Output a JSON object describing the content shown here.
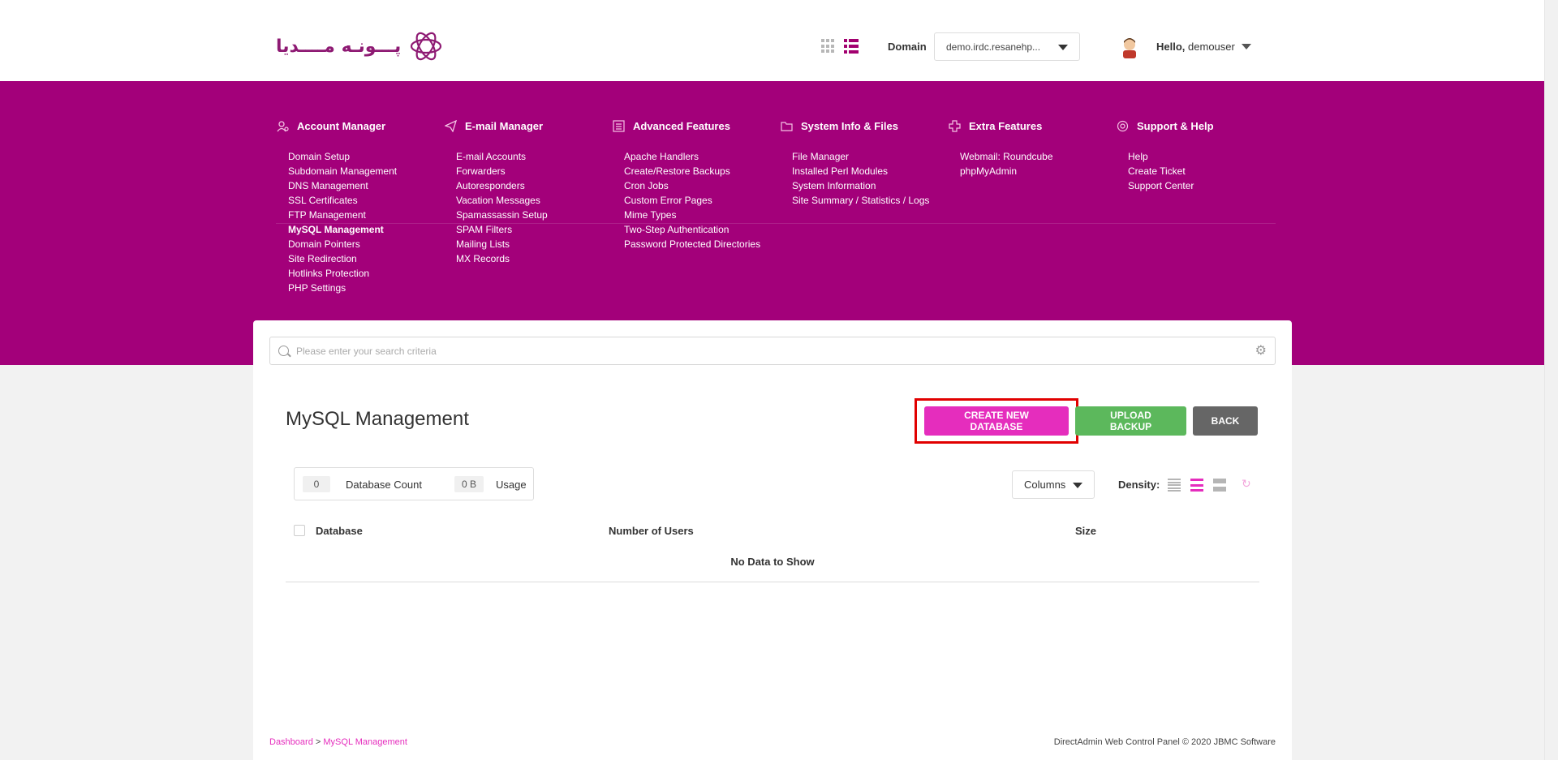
{
  "header": {
    "logo_text": "پـــونـه مــــدیا",
    "domain_label": "Domain",
    "domain_value": "demo.irdc.resanehp...",
    "greeting": "Hello,",
    "username": "demouser"
  },
  "menu": {
    "columns": [
      {
        "title": "Account Manager",
        "icon": "account-icon",
        "items": [
          "Domain Setup",
          "Subdomain Management",
          "DNS Management",
          "SSL Certificates",
          "FTP Management",
          "MySQL Management",
          "Domain Pointers",
          "Site Redirection",
          "Hotlinks Protection",
          "PHP Settings"
        ]
      },
      {
        "title": "E-mail Manager",
        "icon": "paper-plane-icon",
        "items": [
          "E-mail Accounts",
          "Forwarders",
          "Autoresponders",
          "Vacation Messages",
          "Spamassassin Setup",
          "SPAM Filters",
          "Mailing Lists",
          "MX Records"
        ]
      },
      {
        "title": "Advanced Features",
        "icon": "list-icon",
        "items": [
          "Apache Handlers",
          "Create/Restore Backups",
          "Cron Jobs",
          "Custom Error Pages",
          "Mime Types",
          "Two-Step Authentication",
          "Password Protected Directories"
        ]
      },
      {
        "title": "System Info & Files",
        "icon": "folder-icon",
        "items": [
          "File Manager",
          "Installed Perl Modules",
          "System Information",
          "Site Summary / Statistics / Logs"
        ]
      },
      {
        "title": "Extra Features",
        "icon": "plus-icon",
        "items": [
          "Webmail: Roundcube",
          "phpMyAdmin"
        ]
      },
      {
        "title": "Support & Help",
        "icon": "lifebuoy-icon",
        "items": [
          "Help",
          "Create Ticket",
          "Support Center"
        ]
      }
    ],
    "active_item": "MySQL Management"
  },
  "search": {
    "placeholder": "Please enter your search criteria"
  },
  "page": {
    "title": "MySQL Management",
    "buttons": {
      "create": "CREATE NEW DATABASE",
      "upload": "UPLOAD BACKUP",
      "back": "BACK"
    },
    "stats": {
      "count_value": "0",
      "count_label": "Database Count",
      "usage_value": "0 B",
      "usage_label": "Usage"
    },
    "columns_label": "Columns",
    "density_label": "Density:",
    "table": {
      "headers": [
        "Database",
        "Number of Users",
        "Size"
      ],
      "empty_text": "No Data to Show"
    }
  },
  "footer": {
    "breadcrumb": [
      "Dashboard",
      "MySQL Management"
    ],
    "breadcrumb_sep": ">",
    "copyright": "DirectAdmin Web Control Panel © 2020 JBMC Software"
  },
  "colors": {
    "brand": "#a3007a",
    "accent": "#e52dbd",
    "success": "#5cb85c",
    "neutral": "#666666",
    "highlight": "#e10000"
  }
}
